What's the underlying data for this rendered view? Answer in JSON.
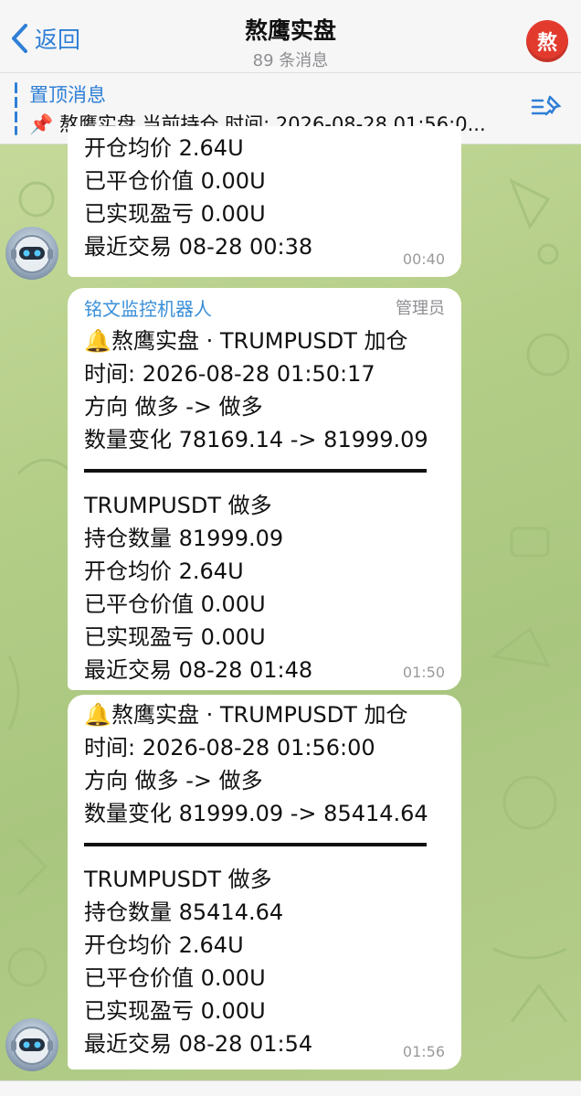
{
  "header": {
    "back_label": "返回",
    "title": "熬鹰实盘",
    "subtitle": "89 条消息",
    "avatar_text": "熬"
  },
  "pinned": {
    "title": "置顶消息",
    "text": "📌 熬鹰实盘 当前持仓 时间: 2026-08-28 01:56:0..."
  },
  "messages": [
    {
      "lines": [
        "开仓均价   2.64U",
        "已平仓价值 0.00U",
        "已实现盈亏 0.00U",
        "最近交易   08-28 00:38"
      ],
      "time": "00:40"
    },
    {
      "sender": "铭文监控机器人",
      "role": "管理员",
      "header_lines": [
        "熬鹰实盘 · TRUMPUSDT 加仓",
        "时间: 2026-08-28 01:50:17",
        "方向        做多 -> 做多",
        "数量变化   78169.14 -> 81999.09"
      ],
      "body_lines": [
        "TRUMPUSDT    做多",
        "持仓数量   81999.09",
        "开仓均价   2.64U",
        "已平仓价值 0.00U",
        "已实现盈亏 0.00U",
        "最近交易   08-28 01:48"
      ],
      "time": "01:50"
    },
    {
      "header_lines": [
        "熬鹰实盘 · TRUMPUSDT 加仓",
        "时间: 2026-08-28 01:56:00",
        "方向        做多 -> 做多",
        "数量变化   81999.09 -> 85414.64"
      ],
      "body_lines": [
        "TRUMPUSDT    做多",
        "持仓数量   85414.64",
        "开仓均价   2.64U",
        "已平仓价值 0.00U",
        "已实现盈亏 0.00U",
        "最近交易   08-28 01:54"
      ],
      "time": "01:56"
    }
  ],
  "icons": {
    "back": "chevron-left-icon",
    "bell": "bell-icon",
    "pin_list": "pinned-list-icon",
    "bot_avatar": "robot-avatar"
  },
  "colors": {
    "accent": "#2f7fd6",
    "chat_bg": "#b7cf8e",
    "avatar_red": "#e23b2e"
  }
}
